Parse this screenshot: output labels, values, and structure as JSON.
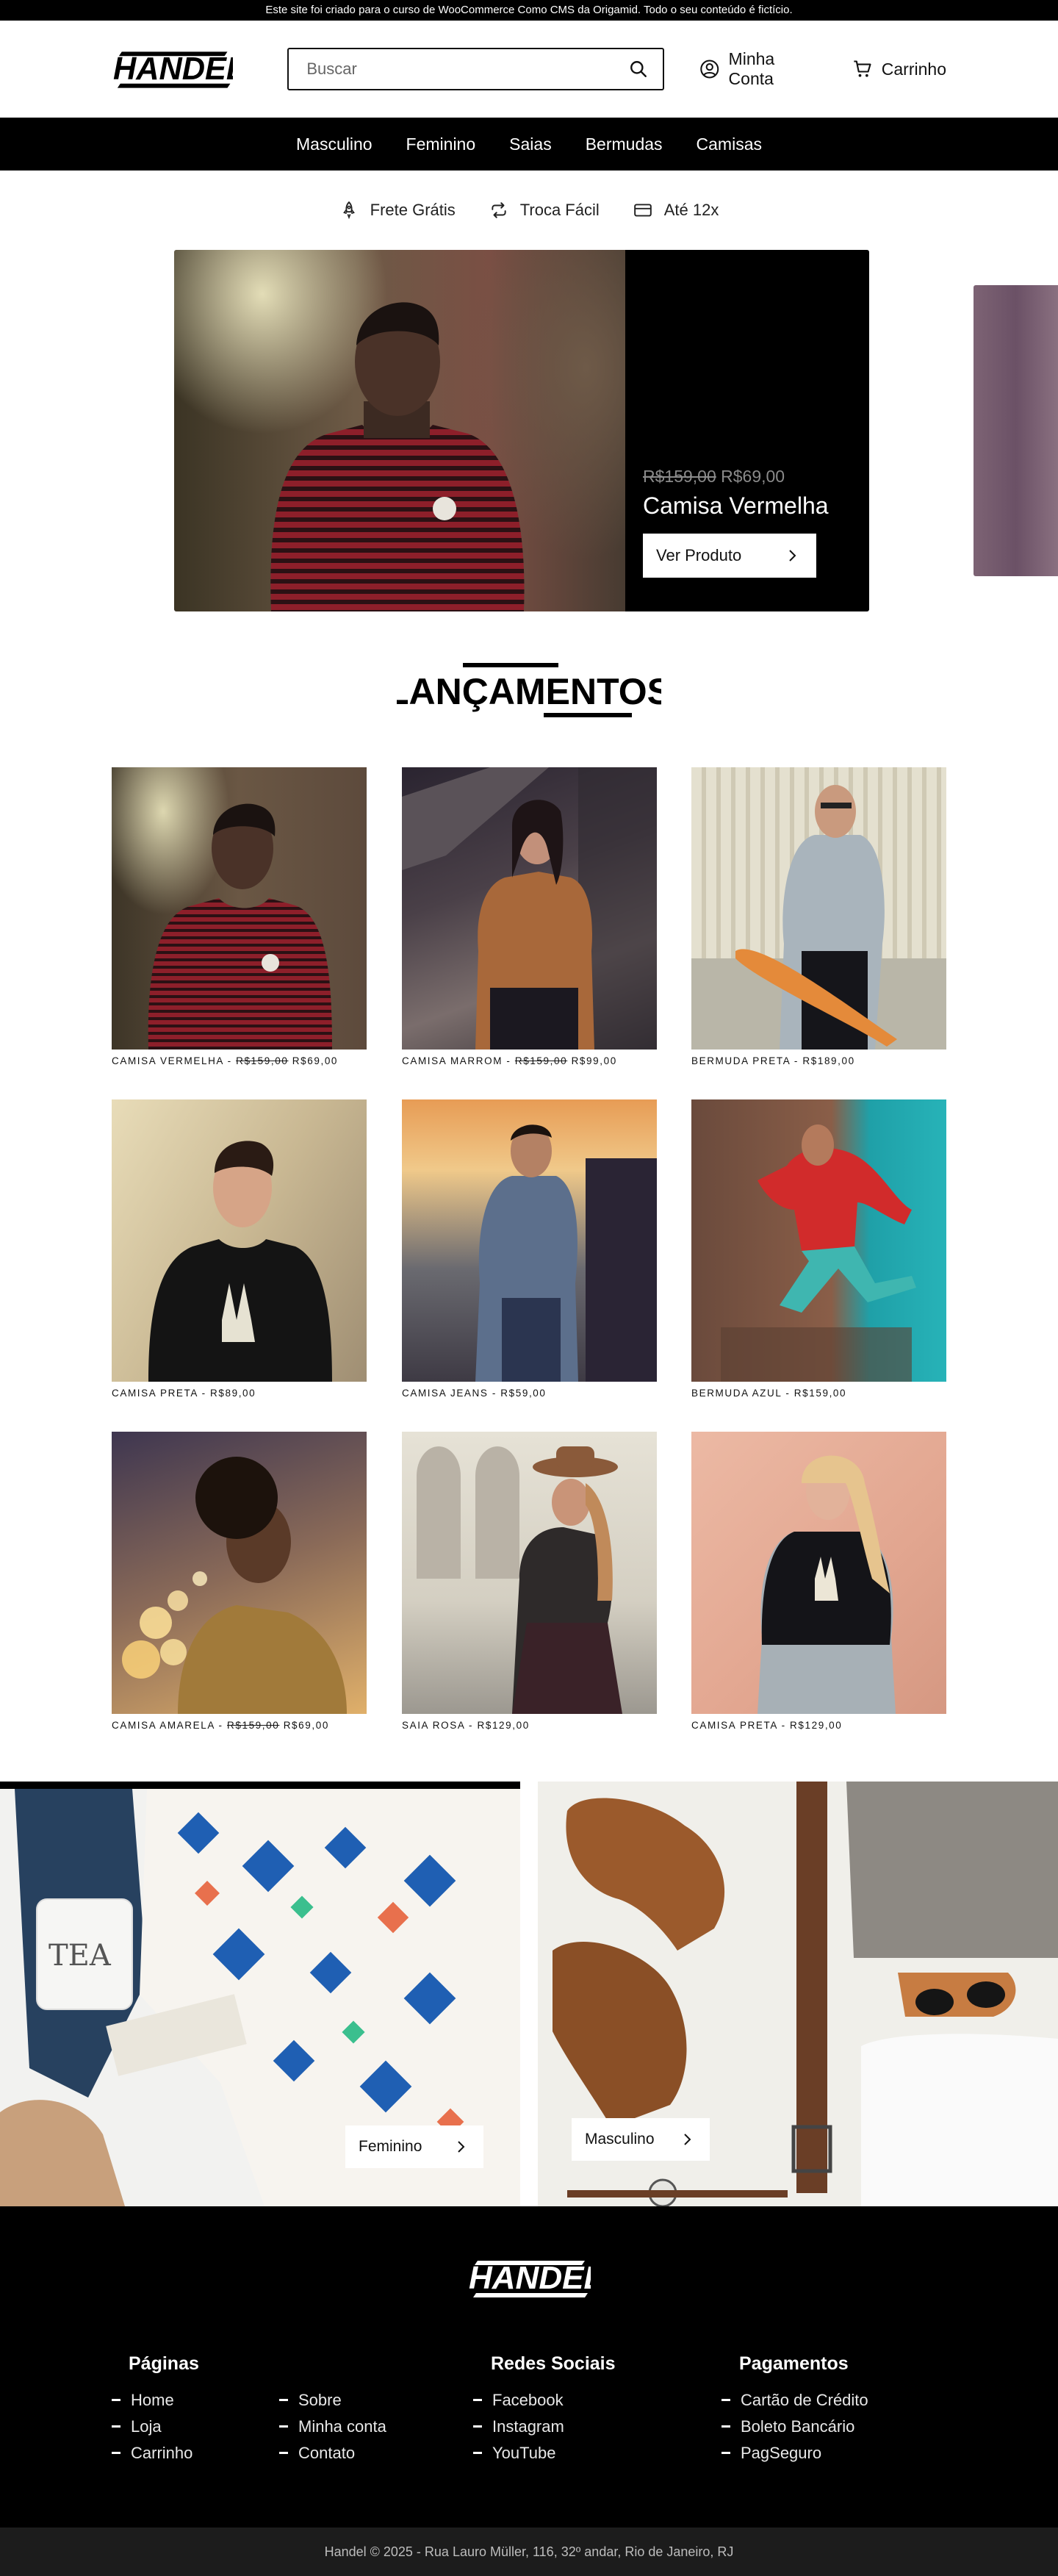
{
  "topbar": {
    "notice": "Este site foi criado para o curso de WooCommerce Como CMS da Origamid. Todo o seu conteúdo é fictício."
  },
  "header": {
    "logo_text": "HANDEL",
    "search_placeholder": "Buscar",
    "account_label": "Minha Conta",
    "cart_label": "Carrinho"
  },
  "nav": {
    "items": [
      "Masculino",
      "Feminino",
      "Saias",
      "Bermudas",
      "Camisas"
    ]
  },
  "benefits": [
    {
      "icon": "rocket-icon",
      "label": "Frete Grátis"
    },
    {
      "icon": "exchange-icon",
      "label": "Troca Fácil"
    },
    {
      "icon": "credit-card-icon",
      "label": "Até 12x"
    }
  ],
  "hero": {
    "old_price": "R$159,00",
    "new_price": "R$69,00",
    "title": "Camisa Vermelha",
    "button_label": "Ver Produto"
  },
  "launches": {
    "title": "LANÇAMENTOS",
    "products": [
      {
        "name": "CAMISA VERMELHA - ",
        "old_price": "R$159,00",
        "price": " R$69,00"
      },
      {
        "name": "CAMISA MARROM - ",
        "old_price": "R$159,00",
        "price": " R$99,00"
      },
      {
        "name": "BERMUDA PRETA - ",
        "old_price": "",
        "price": "R$189,00"
      },
      {
        "name": "CAMISA PRETA - ",
        "old_price": "",
        "price": "R$89,00"
      },
      {
        "name": "CAMISA JEANS - ",
        "old_price": "",
        "price": "R$59,00"
      },
      {
        "name": "BERMUDA AZUL - ",
        "old_price": "",
        "price": "R$159,00"
      },
      {
        "name": "CAMISA AMARELA - ",
        "old_price": "R$159,00",
        "price": " R$69,00"
      },
      {
        "name": "SAIA ROSA - ",
        "old_price": "",
        "price": "R$129,00"
      },
      {
        "name": "CAMISA PRETA - ",
        "old_price": "",
        "price": "R$129,00"
      }
    ]
  },
  "promos": [
    {
      "label": "Feminino"
    },
    {
      "label": "Masculino"
    }
  ],
  "footer": {
    "logo_text": "HANDEL",
    "pages_title": "Páginas",
    "pages_col1": [
      "Home",
      "Loja",
      "Carrinho"
    ],
    "pages_col2": [
      "Sobre",
      "Minha conta",
      "Contato"
    ],
    "social_title": "Redes Sociais",
    "social": [
      "Facebook",
      "Instagram",
      "YouTube"
    ],
    "payments_title": "Pagamentos",
    "payments": [
      "Cartão de Crédito",
      "Boleto Bancário",
      "PagSeguro"
    ],
    "copyright": "Handel © 2025 - Rua Lauro Müller, 116, 32º andar, Rio de Janeiro, RJ"
  }
}
